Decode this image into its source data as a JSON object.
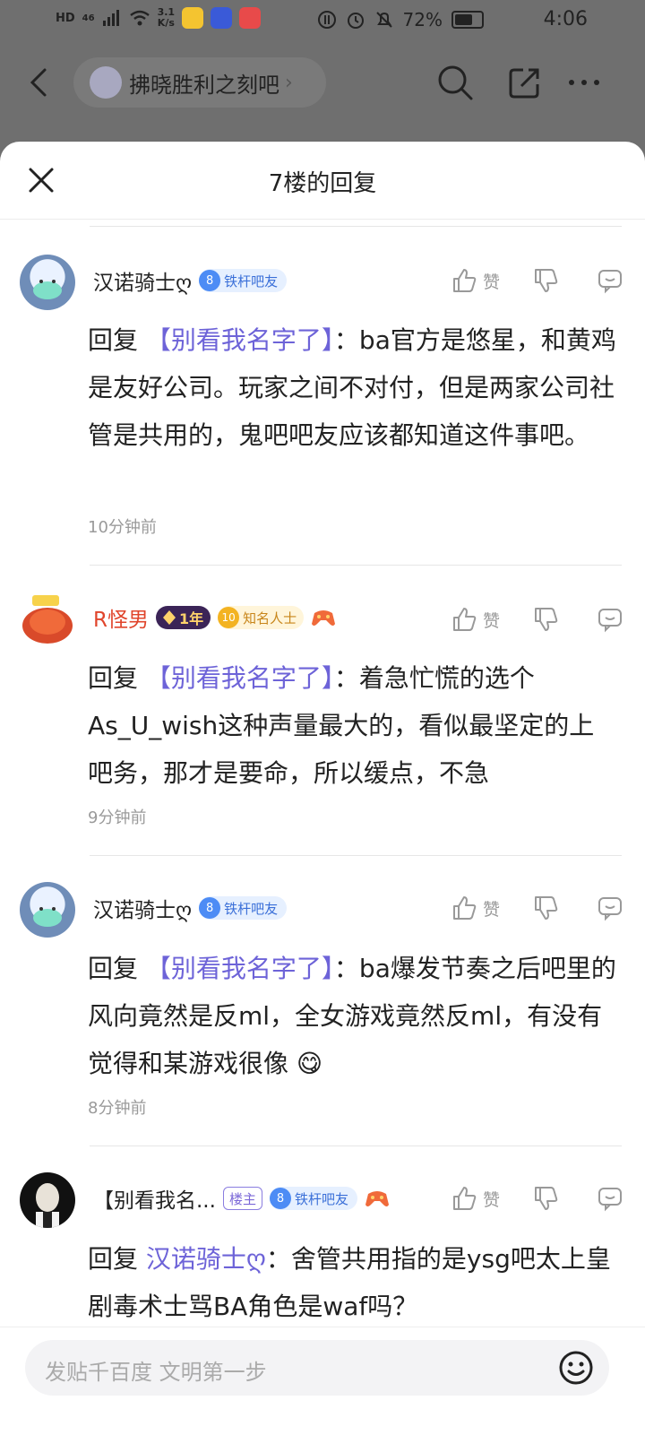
{
  "status_bar": {
    "network": "HD",
    "signal": "46",
    "speed_value": "3.1",
    "speed_unit": "K/s",
    "battery": "72%",
    "battery_level": 0.72,
    "time": "4:06"
  },
  "top_bar": {
    "forum_name": "拂晓胜利之刻吧",
    "chevron": "›"
  },
  "sheet": {
    "title": "7楼的回复"
  },
  "comments": [
    {
      "user": "汉诺骑士ღ",
      "level": "8",
      "level_title": "铁杆吧友",
      "reply_prefix": "回复 ",
      "reply_to": "【别看我名字了】",
      "text": "：ba官方是悠星，和黄鸡是友好公司。玩家之间不对付，但是两家公司社管是共用的，鬼吧吧友应该都知道这件事吧。",
      "time": "10分钟前",
      "like_label": "赞"
    },
    {
      "user": "R怪男",
      "year_badge": "1年",
      "fame_level": "10",
      "fame_title": "知名人士",
      "reply_prefix": "回复 ",
      "reply_to": "【别看我名字了】",
      "text": "：着急忙慌的选个As_U_wish这种声量最大的，看似最坚定的上吧务，那才是要命，所以缓点，不急",
      "time": "9分钟前",
      "like_label": "赞"
    },
    {
      "user": "汉诺骑士ღ",
      "level": "8",
      "level_title": "铁杆吧友",
      "reply_prefix": "回复 ",
      "reply_to": "【别看我名字了】",
      "text": "：ba爆发节奏之后吧里的风向竟然是反ml，全女游戏竟然反ml，有没有觉得和某游戏很像 😋",
      "time": "8分钟前",
      "like_label": "赞"
    },
    {
      "user": "【别看我名...",
      "owner_label": "楼主",
      "level": "8",
      "level_title": "铁杆吧友",
      "reply_prefix": "回复 ",
      "reply_to": "汉诺骑士ღ",
      "text": "：舍管共用指的是ysg吧太上皇剧毒术士骂BA角色是waf吗？",
      "like_label": "赞"
    }
  ],
  "bottom_bar": {
    "placeholder": "发贴千百度 文明第一步"
  }
}
